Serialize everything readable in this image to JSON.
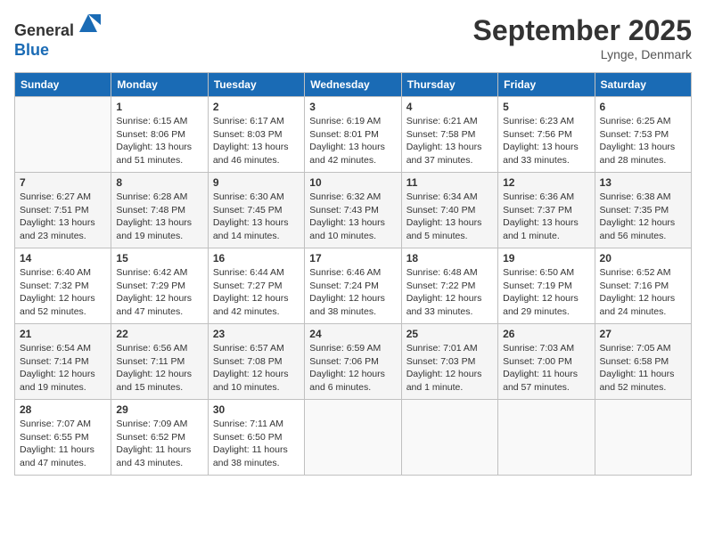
{
  "header": {
    "logo_line1": "General",
    "logo_line2": "Blue",
    "month_title": "September 2025",
    "location": "Lynge, Denmark"
  },
  "weekdays": [
    "Sunday",
    "Monday",
    "Tuesday",
    "Wednesday",
    "Thursday",
    "Friday",
    "Saturday"
  ],
  "weeks": [
    [
      {
        "day": "",
        "info": ""
      },
      {
        "day": "1",
        "info": "Sunrise: 6:15 AM\nSunset: 8:06 PM\nDaylight: 13 hours\nand 51 minutes."
      },
      {
        "day": "2",
        "info": "Sunrise: 6:17 AM\nSunset: 8:03 PM\nDaylight: 13 hours\nand 46 minutes."
      },
      {
        "day": "3",
        "info": "Sunrise: 6:19 AM\nSunset: 8:01 PM\nDaylight: 13 hours\nand 42 minutes."
      },
      {
        "day": "4",
        "info": "Sunrise: 6:21 AM\nSunset: 7:58 PM\nDaylight: 13 hours\nand 37 minutes."
      },
      {
        "day": "5",
        "info": "Sunrise: 6:23 AM\nSunset: 7:56 PM\nDaylight: 13 hours\nand 33 minutes."
      },
      {
        "day": "6",
        "info": "Sunrise: 6:25 AM\nSunset: 7:53 PM\nDaylight: 13 hours\nand 28 minutes."
      }
    ],
    [
      {
        "day": "7",
        "info": "Sunrise: 6:27 AM\nSunset: 7:51 PM\nDaylight: 13 hours\nand 23 minutes."
      },
      {
        "day": "8",
        "info": "Sunrise: 6:28 AM\nSunset: 7:48 PM\nDaylight: 13 hours\nand 19 minutes."
      },
      {
        "day": "9",
        "info": "Sunrise: 6:30 AM\nSunset: 7:45 PM\nDaylight: 13 hours\nand 14 minutes."
      },
      {
        "day": "10",
        "info": "Sunrise: 6:32 AM\nSunset: 7:43 PM\nDaylight: 13 hours\nand 10 minutes."
      },
      {
        "day": "11",
        "info": "Sunrise: 6:34 AM\nSunset: 7:40 PM\nDaylight: 13 hours\nand 5 minutes."
      },
      {
        "day": "12",
        "info": "Sunrise: 6:36 AM\nSunset: 7:37 PM\nDaylight: 13 hours\nand 1 minute."
      },
      {
        "day": "13",
        "info": "Sunrise: 6:38 AM\nSunset: 7:35 PM\nDaylight: 12 hours\nand 56 minutes."
      }
    ],
    [
      {
        "day": "14",
        "info": "Sunrise: 6:40 AM\nSunset: 7:32 PM\nDaylight: 12 hours\nand 52 minutes."
      },
      {
        "day": "15",
        "info": "Sunrise: 6:42 AM\nSunset: 7:29 PM\nDaylight: 12 hours\nand 47 minutes."
      },
      {
        "day": "16",
        "info": "Sunrise: 6:44 AM\nSunset: 7:27 PM\nDaylight: 12 hours\nand 42 minutes."
      },
      {
        "day": "17",
        "info": "Sunrise: 6:46 AM\nSunset: 7:24 PM\nDaylight: 12 hours\nand 38 minutes."
      },
      {
        "day": "18",
        "info": "Sunrise: 6:48 AM\nSunset: 7:22 PM\nDaylight: 12 hours\nand 33 minutes."
      },
      {
        "day": "19",
        "info": "Sunrise: 6:50 AM\nSunset: 7:19 PM\nDaylight: 12 hours\nand 29 minutes."
      },
      {
        "day": "20",
        "info": "Sunrise: 6:52 AM\nSunset: 7:16 PM\nDaylight: 12 hours\nand 24 minutes."
      }
    ],
    [
      {
        "day": "21",
        "info": "Sunrise: 6:54 AM\nSunset: 7:14 PM\nDaylight: 12 hours\nand 19 minutes."
      },
      {
        "day": "22",
        "info": "Sunrise: 6:56 AM\nSunset: 7:11 PM\nDaylight: 12 hours\nand 15 minutes."
      },
      {
        "day": "23",
        "info": "Sunrise: 6:57 AM\nSunset: 7:08 PM\nDaylight: 12 hours\nand 10 minutes."
      },
      {
        "day": "24",
        "info": "Sunrise: 6:59 AM\nSunset: 7:06 PM\nDaylight: 12 hours\nand 6 minutes."
      },
      {
        "day": "25",
        "info": "Sunrise: 7:01 AM\nSunset: 7:03 PM\nDaylight: 12 hours\nand 1 minute."
      },
      {
        "day": "26",
        "info": "Sunrise: 7:03 AM\nSunset: 7:00 PM\nDaylight: 11 hours\nand 57 minutes."
      },
      {
        "day": "27",
        "info": "Sunrise: 7:05 AM\nSunset: 6:58 PM\nDaylight: 11 hours\nand 52 minutes."
      }
    ],
    [
      {
        "day": "28",
        "info": "Sunrise: 7:07 AM\nSunset: 6:55 PM\nDaylight: 11 hours\nand 47 minutes."
      },
      {
        "day": "29",
        "info": "Sunrise: 7:09 AM\nSunset: 6:52 PM\nDaylight: 11 hours\nand 43 minutes."
      },
      {
        "day": "30",
        "info": "Sunrise: 7:11 AM\nSunset: 6:50 PM\nDaylight: 11 hours\nand 38 minutes."
      },
      {
        "day": "",
        "info": ""
      },
      {
        "day": "",
        "info": ""
      },
      {
        "day": "",
        "info": ""
      },
      {
        "day": "",
        "info": ""
      }
    ]
  ]
}
